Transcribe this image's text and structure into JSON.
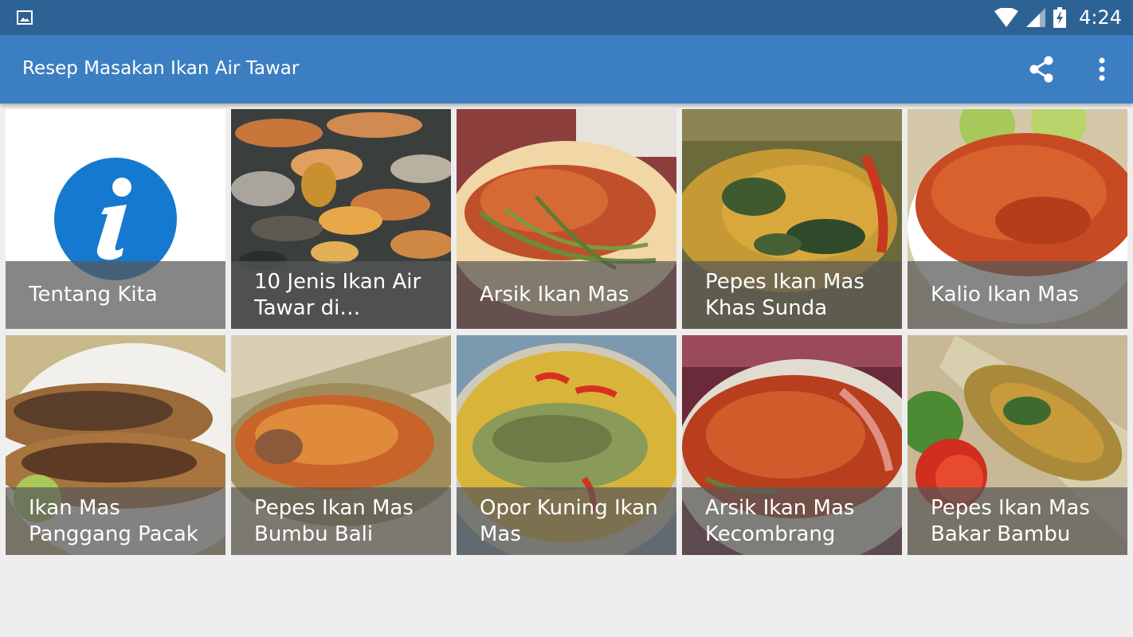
{
  "status_bar": {
    "time": "4:24",
    "icons": [
      "gallery-icon",
      "wifi-icon",
      "cell-signal-icon",
      "battery-charging-icon"
    ]
  },
  "app_bar": {
    "title": "Resep Masakan Ikan Air Tawar",
    "actions": [
      "share-icon",
      "more-vert-icon"
    ],
    "color": "#3b7ec1"
  },
  "colors": {
    "status_bar": "#2d6295",
    "app_bar": "#3b7ec1",
    "background": "#eeeeee",
    "info_icon": "#1479cf"
  },
  "grid": {
    "items": [
      {
        "label": "Tentang Kita",
        "image": "info-icon"
      },
      {
        "label": "10 Jenis Ikan Air Tawar di…",
        "image": "koi-fish-pond-photo"
      },
      {
        "label": "Arsik Ikan Mas",
        "image": "arsik-fish-dish-photo"
      },
      {
        "label": "Pepes Ikan Mas Khas Sunda",
        "image": "pepes-banana-leaf-photo"
      },
      {
        "label": "Kalio Ikan Mas",
        "image": "kalio-fish-curry-photo"
      },
      {
        "label": "Ikan Mas Panggang Pacak",
        "image": "grilled-fish-plate-photo"
      },
      {
        "label": "Pepes Ikan Mas Bumbu Bali",
        "image": "pepes-bali-spice-photo"
      },
      {
        "label": "Opor Kuning Ikan Mas",
        "image": "yellow-curry-fish-photo"
      },
      {
        "label": "Arsik Ikan Mas Kecombrang",
        "image": "arsik-kecombrang-photo"
      },
      {
        "label": "Pepes Ikan Mas Bakar Bambu",
        "image": "bamboo-grilled-fish-photo"
      }
    ]
  }
}
